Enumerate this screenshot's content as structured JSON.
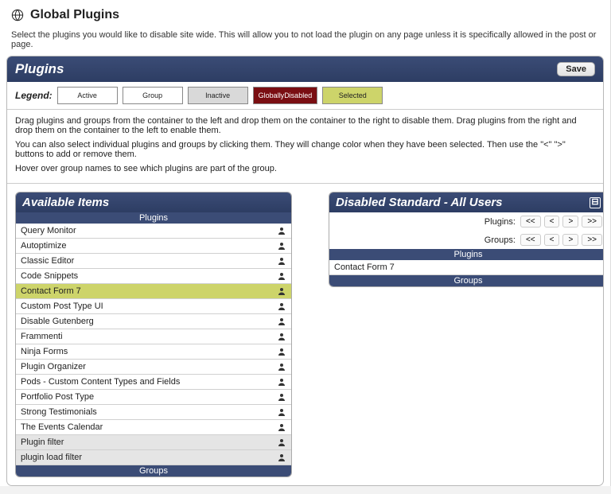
{
  "header": {
    "title": "Global Plugins",
    "intro": "Select the plugins you would like to disable site wide. This will allow you to not load the plugin on any page unless it is specifically allowed in the post or page."
  },
  "panel": {
    "title": "Plugins",
    "save_label": "Save"
  },
  "legend": {
    "label": "Legend:",
    "active": "Active",
    "group": "Group",
    "inactive": "Inactive",
    "gdisabled1": "Globally",
    "gdisabled2": "Disabled",
    "selected": "Selected"
  },
  "instructions": [
    "Drag plugins and groups from the container to the left and drop them on the container to the right to disable them. Drag plugins from the right and drop them on the container to the left to enable them.",
    "You can also select individual plugins and groups by clicking them. They will change color when they have been selected. Then use the \"<\" \">\" buttons to add or remove them.",
    "Hover over group names to see which plugins are part of the group."
  ],
  "available": {
    "title": "Available Items",
    "plugins_header": "Plugins",
    "groups_header": "Groups",
    "items": [
      {
        "label": "Query Monitor",
        "state": "active"
      },
      {
        "label": "Autoptimize",
        "state": "active"
      },
      {
        "label": "Classic Editor",
        "state": "active"
      },
      {
        "label": "Code Snippets",
        "state": "active"
      },
      {
        "label": "Contact Form 7",
        "state": "selected"
      },
      {
        "label": "Custom Post Type UI",
        "state": "active"
      },
      {
        "label": "Disable Gutenberg",
        "state": "active"
      },
      {
        "label": "Frammenti",
        "state": "active"
      },
      {
        "label": "Ninja Forms",
        "state": "active"
      },
      {
        "label": "Plugin Organizer",
        "state": "active"
      },
      {
        "label": "Pods - Custom Content Types and Fields",
        "state": "active"
      },
      {
        "label": "Portfolio Post Type",
        "state": "active"
      },
      {
        "label": "Strong Testimonials",
        "state": "active"
      },
      {
        "label": "The Events Calendar",
        "state": "active"
      },
      {
        "label": "Plugin filter",
        "state": "inactive"
      },
      {
        "label": "plugin load filter",
        "state": "inactive"
      }
    ]
  },
  "disabled": {
    "title": "Disabled Standard - All Users",
    "plugins_ctrl": "Plugins:",
    "groups_ctrl": "Groups:",
    "plugins_header": "Plugins",
    "groups_header": "Groups",
    "items": [
      "Contact Form 7"
    ]
  },
  "controls": {
    "all_left": "<<",
    "left": "<",
    "right": ">",
    "all_right": ">>"
  }
}
